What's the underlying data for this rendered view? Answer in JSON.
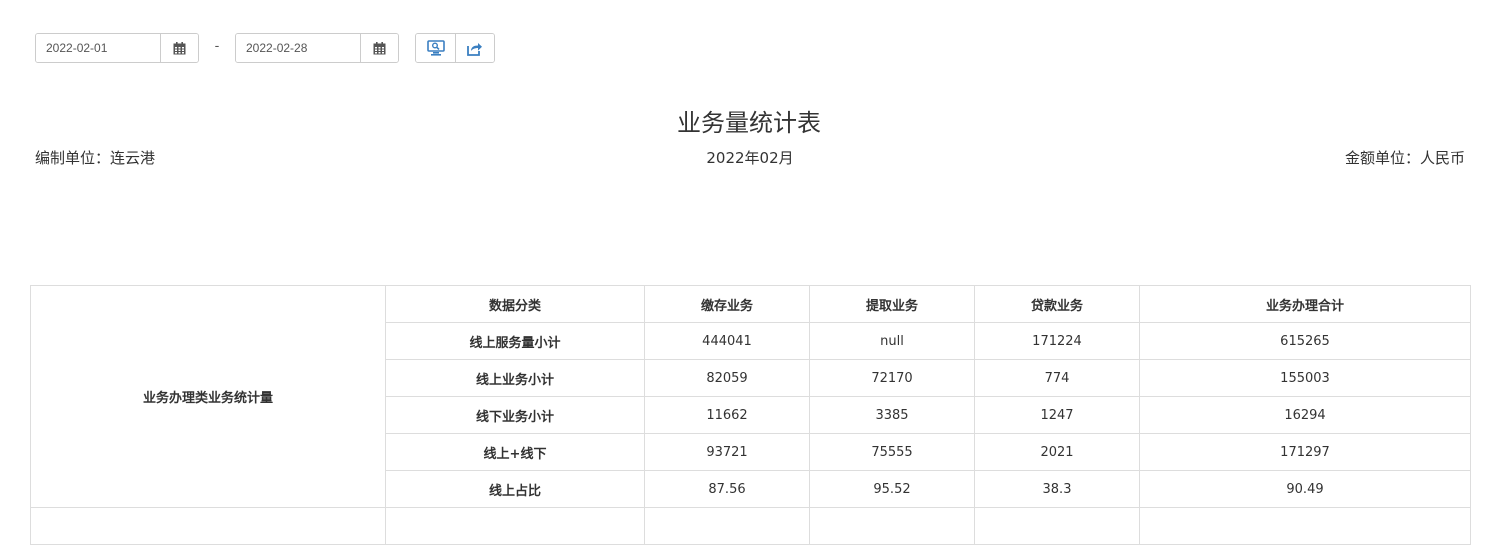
{
  "filters": {
    "start_date": "2022-02-01",
    "separator": "-",
    "end_date": "2022-02-28"
  },
  "icons": {
    "calendar": "calendar-icon",
    "preview": "monitor-search-icon",
    "export": "share-export-icon"
  },
  "colors": {
    "icon_blue": "#3a7fc1",
    "border": "#dddddd"
  },
  "report": {
    "title": "业务量统计表",
    "org_label": "编制单位：连云港",
    "period": "2022年02月",
    "currency_label": "金额单位：人民币"
  },
  "table": {
    "group_label": "业务办理类业务统计量",
    "headers": [
      "数据分类",
      "缴存业务",
      "提取业务",
      "贷款业务",
      "业务办理合计"
    ],
    "rows": [
      {
        "label": "线上服务量小计",
        "values": [
          "444041",
          "null",
          "171224",
          "615265"
        ]
      },
      {
        "label": "线上业务小计",
        "values": [
          "82059",
          "72170",
          "774",
          "155003"
        ]
      },
      {
        "label": "线下业务小计",
        "values": [
          "11662",
          "3385",
          "1247",
          "16294"
        ]
      },
      {
        "label": "线上+线下",
        "values": [
          "93721",
          "75555",
          "2021",
          "171297"
        ]
      },
      {
        "label": "线上占比",
        "values": [
          "87.56",
          "95.52",
          "38.3",
          "90.49"
        ]
      }
    ]
  }
}
